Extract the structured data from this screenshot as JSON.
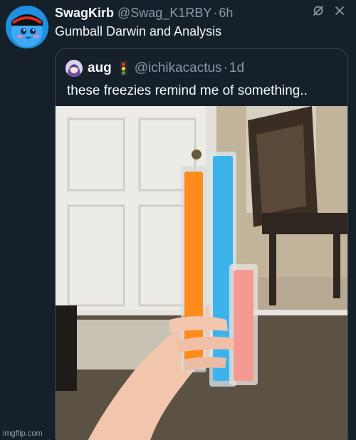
{
  "tweet": {
    "display_name": "SwagKirb",
    "handle": "@Swag_K1RBY",
    "separator": "·",
    "time": "6h",
    "text": "Gumball Darwin and Analysis",
    "actions": [
      "grok-icon",
      "close-icon"
    ]
  },
  "quoted_tweet": {
    "display_name": "aug",
    "badge": "traffic-light-emoji",
    "handle": "@ichikacactus",
    "separator": "·",
    "time": "1d",
    "text": "these freezies remind me of something..",
    "image": {
      "description_icon": "photo-of-freezies",
      "freezie_colors": [
        "#ff8c1a",
        "#3bb4ee",
        "#f59a93"
      ]
    }
  },
  "watermark": "imgflip.com",
  "colors": {
    "background": "#15202b",
    "text": "#f7f9f9",
    "muted": "#8b98a5",
    "border": "#38444d"
  }
}
